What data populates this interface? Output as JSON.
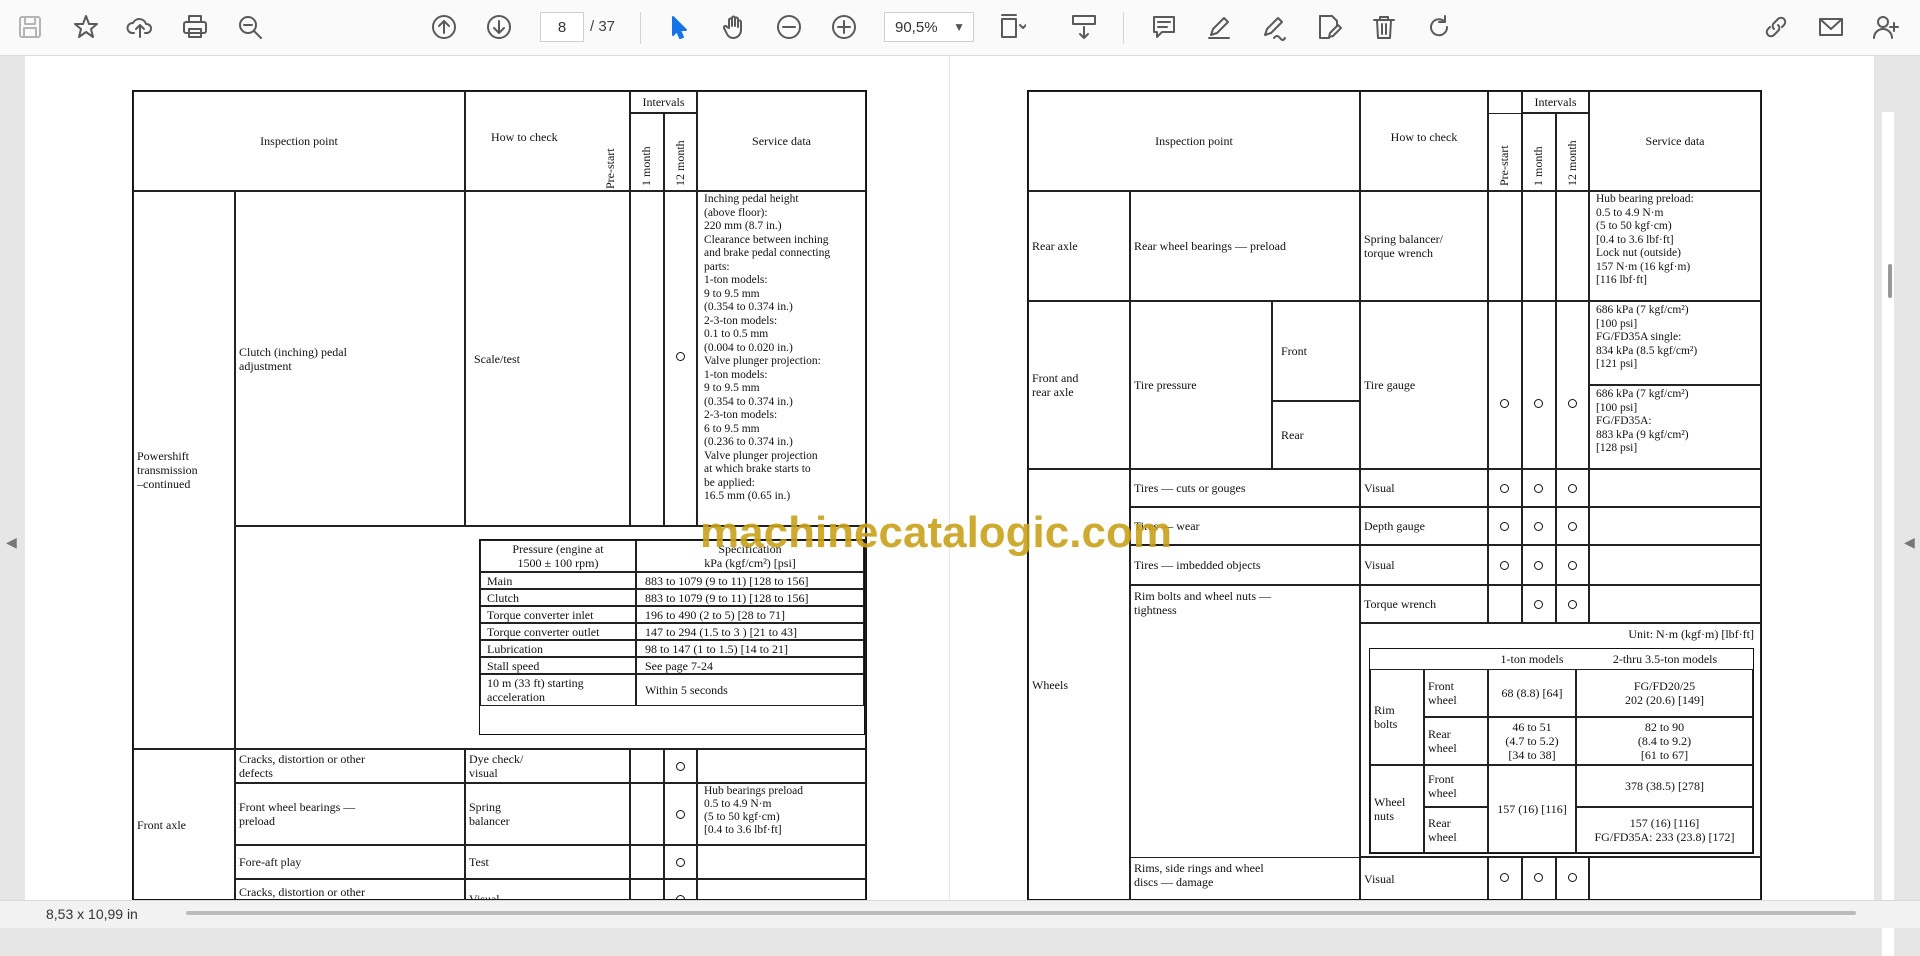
{
  "toolbar": {
    "page_current": "8",
    "page_total": "/ 37",
    "zoom": "90,5%"
  },
  "status": {
    "page_size": "8,53 x 10,99 in"
  },
  "watermark": "machinecatalogic.com",
  "left_page": {
    "header": {
      "inspection_point": "Inspection point",
      "how_to_check": "How to check",
      "pre_start": "Pre-start",
      "intervals": "Intervals",
      "one_month": "1 month",
      "twelve_month": "12 month",
      "service_data": "Service data"
    },
    "group_powershift": "Powershift\ntransmission\n–continued",
    "clutch_item": "Clutch (inching) pedal\nadjustment",
    "clutch_check": "Scale/test",
    "clutch_service": "Inching pedal height\n(above floor):\n   220 mm (8.7 in.)\nClearance between inching\nand brake pedal connecting\nparts:\n   1-ton models:\n   9 to 9.5 mm\n   (0.354 to 0.374 in.)\n   2-3-ton models:\n   0.1 to 0.5 mm\n   (0.004 to 0.020 in.)\nValve plunger projection:\n   1-ton models:\n   9 to 9.5 mm\n   (0.354 to 0.374 in.)\n   2-3-ton models:\n   6 to 9.5 mm\n   (0.236 to 0.374 in.)\nValve plunger projection\nat which brake starts to\nbe applied:\n   16.5 mm (0.65 in.)",
    "pressure_header_left": "Pressure (engine at\n1500 ± 100 rpm)",
    "pressure_header_right": "Specification\nkPa (kgf/cm²) [psi]",
    "pressure_rows": [
      {
        "name": "Main",
        "value": "883 to 1079 (9 to 11) [128 to 156]"
      },
      {
        "name": "Clutch",
        "value": "883 to 1079 (9 to 11) [128 to 156]"
      },
      {
        "name": "Torque converter inlet",
        "value": "196 to 490 (2 to 5) [28 to 71]"
      },
      {
        "name": "Torque converter outlet",
        "value": "147 to 294 (1.5 to 3 ) [21 to 43]"
      },
      {
        "name": "Lubrication",
        "value": "98 to 147 (1 to 1.5) [14 to 21]"
      },
      {
        "name": "Stall speed",
        "value": "See page 7-24"
      },
      {
        "name": "10 m (33 ft) starting\nacceleration",
        "value": "Within 5 seconds"
      }
    ],
    "group_front_axle": "Front axle",
    "fa_rows": [
      {
        "item": "Cracks, distortion or other\ndefects",
        "check": "Dye check/\nvisual",
        "service": ""
      },
      {
        "item": "Front wheel bearings —\npreload",
        "check": "Spring\nbalancer",
        "service": "Hub bearings preload\n   0.5 to 4.9 N·m\n   (5 to 50 kgf·cm)\n   [0.4 to 3.6 lbf·ft]"
      },
      {
        "item": "Fore-aft play",
        "check": "Test",
        "service": ""
      },
      {
        "item": "Cracks, distortion or other\ndefects",
        "check": "Visual",
        "service": ""
      }
    ]
  },
  "right_page": {
    "header": {
      "inspection_point": "Inspection point",
      "how_to_check": "How to check",
      "pre_start": "Pre-start",
      "intervals": "Intervals",
      "one_month": "1 month",
      "twelve_month": "12 month",
      "service_data": "Service data"
    },
    "rear_axle": {
      "group": "Rear axle",
      "item": "Rear wheel bearings — preload",
      "check": "Spring balancer/\ntorque wrench",
      "service": "Hub bearing preload:\n   0.5 to 4.9 N·m\n   (5 to 50 kgf·cm)\n   [0.4 to 3.6 lbf·ft]\nLock nut (outside)\n   157 N·m (16 kgf·m)\n   [116 lbf·ft]"
    },
    "tire": {
      "group": "Front and\nrear axle",
      "item": "Tire pressure",
      "front": "Front",
      "rear": "Rear",
      "check": "Tire gauge",
      "front_service": "686 kPa (7 kgf/cm²)\n[100 psi]\nFG/FD35A single:\n834 kPa (8.5 kgf/cm²)\n[121 psi]",
      "rear_service": "686 kPa (7 kgf/cm²)\n[100 psi]\nFG/FD35A:\n883 kPa (9 kgf/cm²)\n[128 psi]"
    },
    "wheels_group": "Wheels",
    "wheel_rows": [
      {
        "item": "Tires — cuts or gouges",
        "check": "Visual"
      },
      {
        "item": "Tires — wear",
        "check": "Depth gauge"
      },
      {
        "item": "Tires — imbedded objects",
        "check": "Visual"
      },
      {
        "item": "Rim bolts and wheel nuts —\ntightness",
        "check": "Torque wrench"
      }
    ],
    "torque": {
      "unit": "Unit: N·m (kgf·m) [lbf·ft]",
      "col1": "1-ton models",
      "col2": "2-thru 3.5-ton models",
      "rim_bolts": "Rim\nbolts",
      "wheel_nuts": "Wheel\nnuts",
      "front_wheel": "Front\nwheel",
      "rear_wheel": "Rear\nwheel",
      "rb_front_1": "68 (8.8) [64]",
      "rb_front_2": "FG/FD20/25\n202 (20.6) [149]",
      "rb_rear_1": "46 to 51\n(4.7 to 5.2)\n[34 to 38]",
      "rb_rear_2": "82 to 90\n(8.4 to 9.2)\n[61 to 67]",
      "wn_1": "157 (16) [116]",
      "wn_front_2": "378 (38.5) [278]",
      "wn_rear_2": "157 (16) [116]\nFG/FD35A: 233 (23.8) [172]"
    },
    "rims_item": "Rims, side rings and wheel\ndiscs — damage",
    "rims_check": "Visual"
  }
}
